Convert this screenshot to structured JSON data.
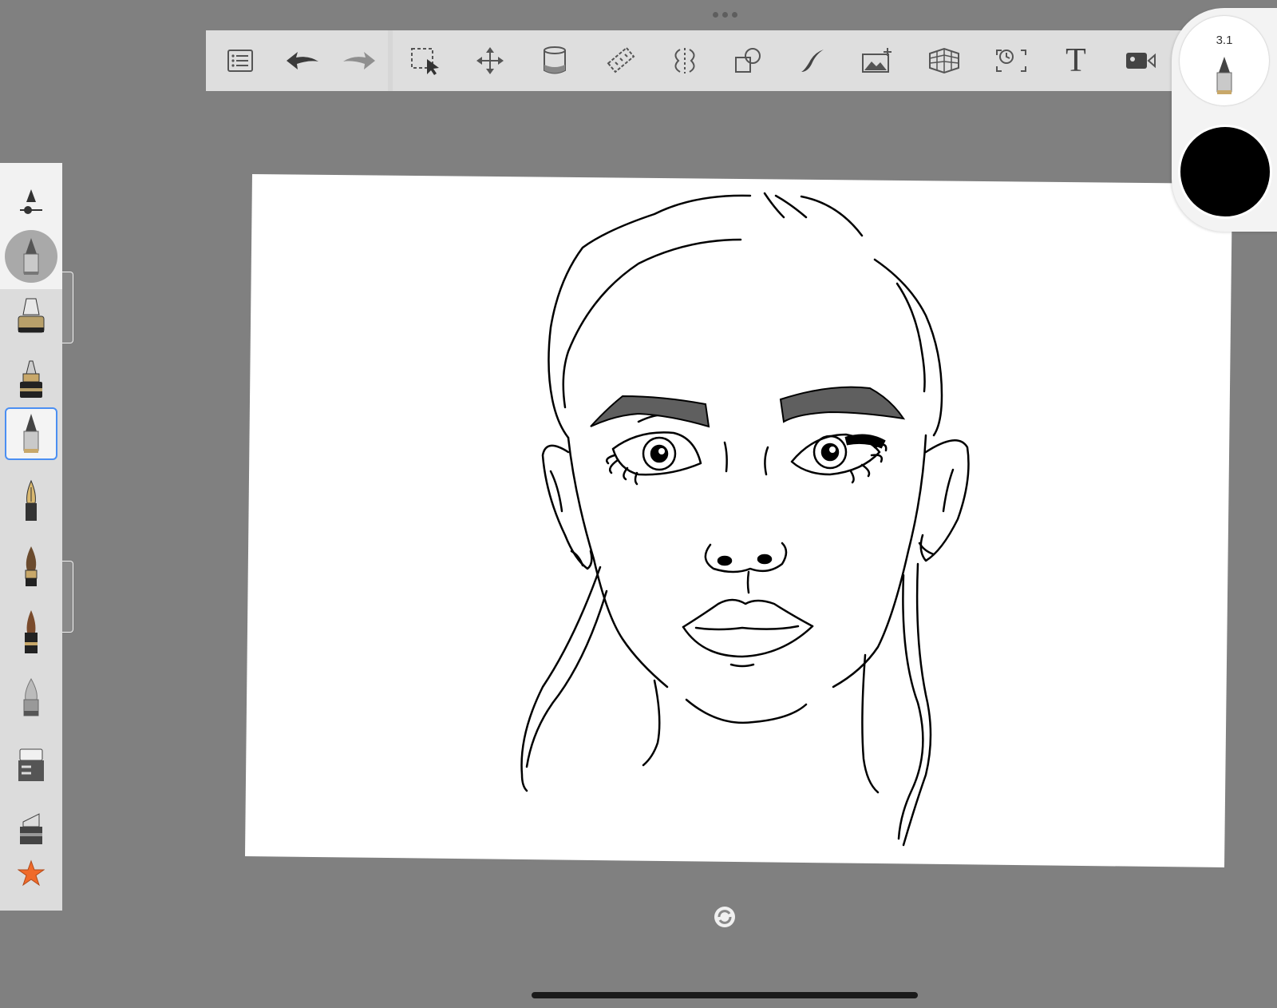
{
  "app": {
    "name": "sketch-drawing-app"
  },
  "toolbar": {
    "tools": [
      {
        "id": "gallery",
        "icon": "list-icon"
      },
      {
        "id": "undo",
        "icon": "undo-arrow-icon"
      },
      {
        "id": "redo",
        "icon": "redo-arrow-icon"
      },
      {
        "id": "selection",
        "icon": "selection-icon"
      },
      {
        "id": "transform",
        "icon": "move-arrows-icon"
      },
      {
        "id": "fill",
        "icon": "paint-bucket-icon"
      },
      {
        "id": "ruler",
        "icon": "ruler-icon"
      },
      {
        "id": "symmetry",
        "icon": "symmetry-icon"
      },
      {
        "id": "shapes",
        "icon": "shapes-icon"
      },
      {
        "id": "stroke",
        "icon": "curve-stroke-icon"
      },
      {
        "id": "import-image",
        "icon": "add-image-icon"
      },
      {
        "id": "perspective",
        "icon": "perspective-grid-icon"
      },
      {
        "id": "timelapse",
        "icon": "time-lapse-icon"
      },
      {
        "id": "text",
        "icon": "text-icon"
      },
      {
        "id": "record",
        "icon": "video-camera-icon"
      }
    ],
    "text_tool_label": "T"
  },
  "brush_puck": {
    "size_label": "3.1",
    "current_color": "#000000"
  },
  "brushes": [
    "brush-property-slider-icon",
    "pencil-icon",
    "inking-pen-icon",
    "ballpoint-pen-icon",
    "technical-pencil-icon",
    "fountain-pen-icon",
    "paint-brush-icon",
    "airbrush-icon",
    "marker-icon",
    "eraser-icon",
    "chisel-marker-icon",
    "favorite-star-icon"
  ],
  "colors": {
    "background": "#808080",
    "toolbar": "#dedede",
    "accent_selected": "#4b8ff2",
    "star": "#f06a2a",
    "eyebrow_fill": "#5f5f5f"
  }
}
